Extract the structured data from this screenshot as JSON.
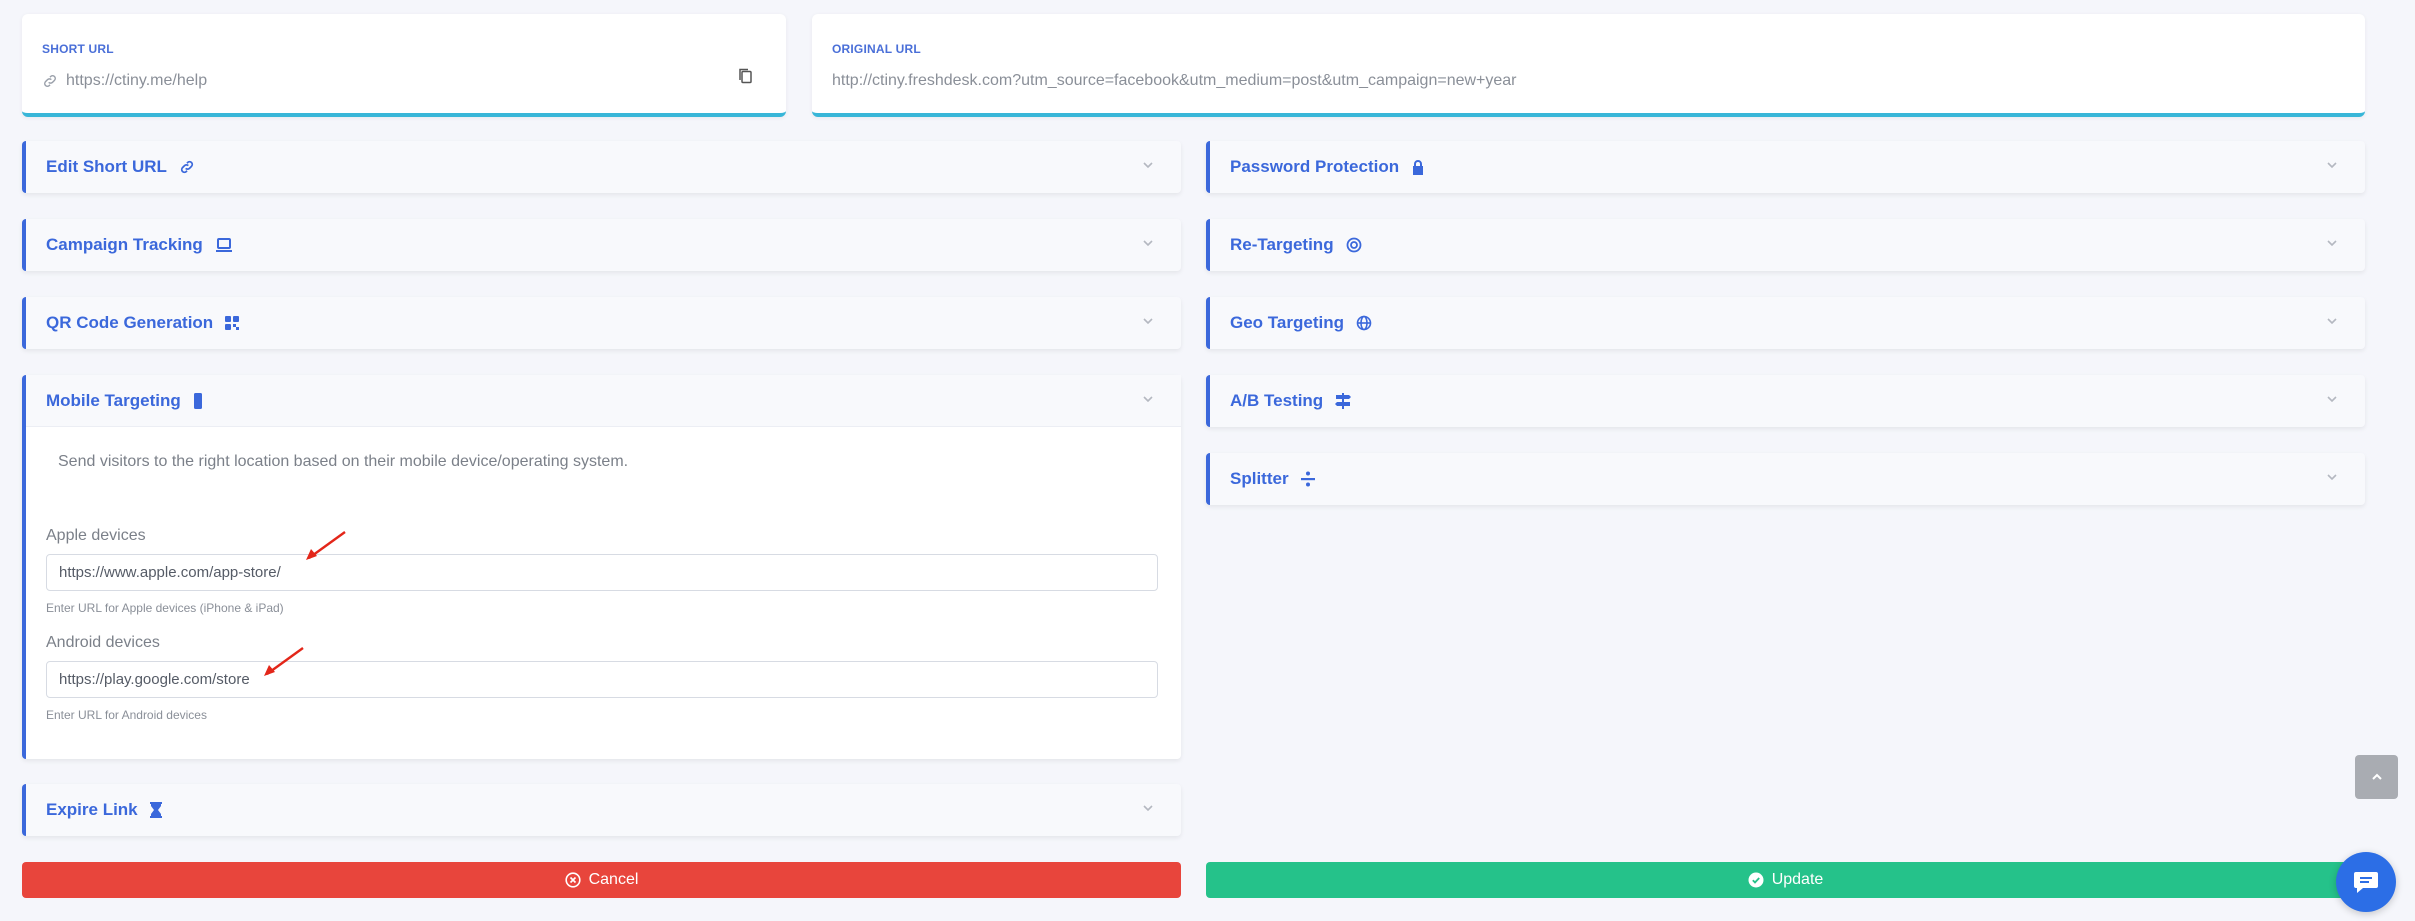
{
  "short_url": {
    "label": "SHORT URL",
    "value": "https://ctiny.me/help"
  },
  "original_url": {
    "label": "ORIGINAL URL",
    "value": "http://ctiny.freshdesk.com?utm_source=facebook&utm_medium=post&utm_campaign=new+year"
  },
  "panels_left": {
    "edit_short_url": "Edit Short URL",
    "campaign_tracking": "Campaign Tracking",
    "qr_code": "QR Code Generation",
    "mobile_targeting": "Mobile Targeting",
    "expire_link": "Expire Link"
  },
  "panels_right": {
    "password_protection": "Password Protection",
    "re_targeting": "Re-Targeting",
    "geo_targeting": "Geo Targeting",
    "ab_testing": "A/B Testing",
    "splitter": "Splitter"
  },
  "mobile": {
    "description": "Send visitors to the right location based on their mobile device/operating system.",
    "apple_label": "Apple devices",
    "apple_value": "https://www.apple.com/app-store/",
    "apple_hint": "Enter URL for Apple devices (iPhone & iPad)",
    "android_label": "Android devices",
    "android_value": "https://play.google.com/store",
    "android_hint": "Enter URL for Android devices"
  },
  "actions": {
    "cancel": "Cancel",
    "update": "Update"
  },
  "colors": {
    "accent": "#3b68db",
    "cancel": "#e8453c",
    "update": "#25c28a",
    "chat": "#2c6ee6"
  }
}
